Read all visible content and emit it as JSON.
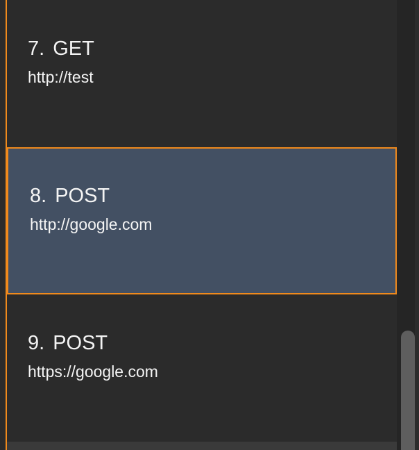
{
  "request_list": {
    "items": [
      {
        "index": "7.",
        "method": "GET",
        "url": "http://test",
        "selected": false
      },
      {
        "index": "8.",
        "method": "POST",
        "url": "http://google.com",
        "selected": true
      },
      {
        "index": "9.",
        "method": "POST",
        "url": "https://google.com",
        "selected": false
      }
    ]
  },
  "scrollbar": {
    "position": 0.82
  },
  "colors": {
    "background": "#2b2b2b",
    "selected_background": "#435063",
    "accent": "#f08a1c",
    "text": "#f4f4f4",
    "scroll_thumb": "#5e5e5e"
  }
}
